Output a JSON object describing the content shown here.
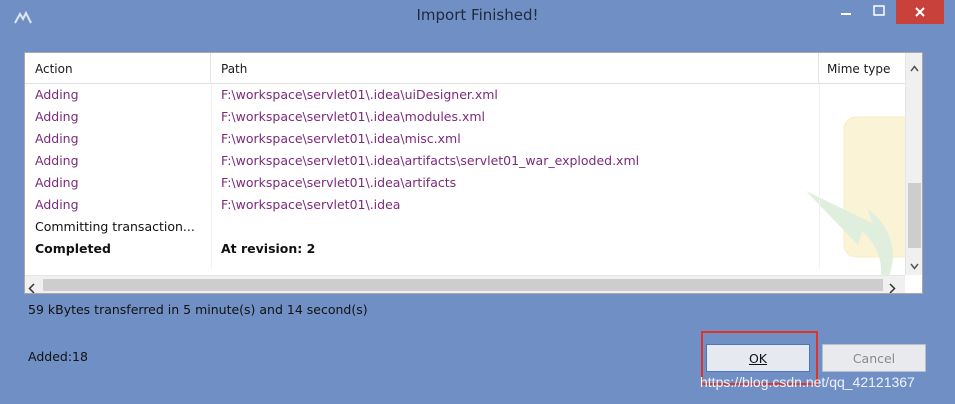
{
  "window": {
    "title": "Import Finished!"
  },
  "table": {
    "headers": {
      "action": "Action",
      "path": "Path",
      "mime": "Mime type"
    },
    "rows": [
      {
        "action": "Adding",
        "path": "F:\\workspace\\servlet01\\.idea\\uiDesigner.xml",
        "style": "adding"
      },
      {
        "action": "Adding",
        "path": "F:\\workspace\\servlet01\\.idea\\modules.xml",
        "style": "adding"
      },
      {
        "action": "Adding",
        "path": "F:\\workspace\\servlet01\\.idea\\misc.xml",
        "style": "adding"
      },
      {
        "action": "Adding",
        "path": "F:\\workspace\\servlet01\\.idea\\artifacts\\servlet01_war_exploded.xml",
        "style": "adding"
      },
      {
        "action": "Adding",
        "path": "F:\\workspace\\servlet01\\.idea\\artifacts",
        "style": "adding"
      },
      {
        "action": "Adding",
        "path": "F:\\workspace\\servlet01\\.idea",
        "style": "adding"
      },
      {
        "action": "Committing transaction...",
        "path": "",
        "style": "plain"
      },
      {
        "action": "Completed",
        "path": "At revision: 2",
        "style": "bold"
      }
    ]
  },
  "status": {
    "transfer": "59 kBytes transferred in 5 minute(s) and 14 second(s)",
    "added": "Added:18"
  },
  "buttons": {
    "ok": "OK",
    "cancel": "Cancel"
  },
  "watermark": "https://blog.csdn.net/qq_42121367",
  "colors": {
    "title_bar": "#7090c5",
    "close_button": "#c9413b",
    "adding_text": "#7b2a7b",
    "highlight": "#e0342b"
  },
  "icons": [
    "app-icon",
    "minimize-icon",
    "maximize-icon",
    "close-icon",
    "scroll-up-icon",
    "scroll-down-icon",
    "scroll-left-icon",
    "scroll-right-icon"
  ]
}
